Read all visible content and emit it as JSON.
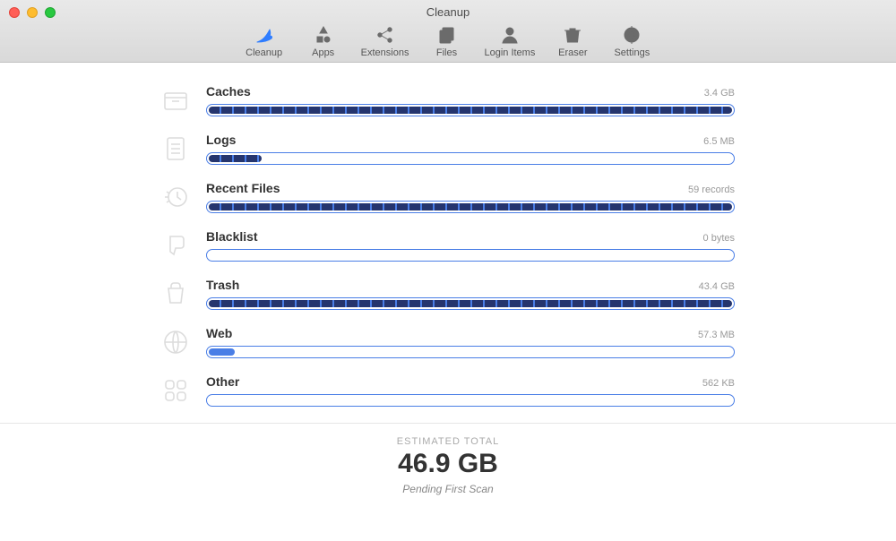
{
  "window": {
    "title": "Cleanup"
  },
  "toolbar": {
    "items": [
      {
        "label": "Cleanup",
        "active": true
      },
      {
        "label": "Apps",
        "active": false
      },
      {
        "label": "Extensions",
        "active": false
      },
      {
        "label": "Files",
        "active": false
      },
      {
        "label": "Login Items",
        "active": false
      },
      {
        "label": "Eraser",
        "active": false
      },
      {
        "label": "Settings",
        "active": false
      }
    ]
  },
  "categories": [
    {
      "name": "Caches",
      "size": "3.4 GB",
      "fill_pct": 100,
      "segmented": true
    },
    {
      "name": "Logs",
      "size": "6.5 MB",
      "fill_pct": 10,
      "segmented": true
    },
    {
      "name": "Recent Files",
      "size": "59 records",
      "fill_pct": 100,
      "segmented": true
    },
    {
      "name": "Blacklist",
      "size": "0 bytes",
      "fill_pct": 0,
      "segmented": false
    },
    {
      "name": "Trash",
      "size": "43.4 GB",
      "fill_pct": 100,
      "segmented": true
    },
    {
      "name": "Web",
      "size": "57.3 MB",
      "fill_pct": 5,
      "segmented": false
    },
    {
      "name": "Other",
      "size": "562 KB",
      "fill_pct": 0,
      "segmented": false
    }
  ],
  "footer": {
    "label": "ESTIMATED TOTAL",
    "value": "46.9 GB",
    "status": "Pending First Scan"
  }
}
